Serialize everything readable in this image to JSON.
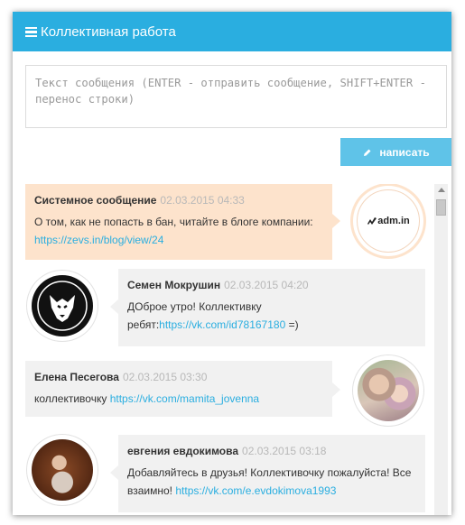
{
  "header": {
    "title": "Коллективная работа",
    "menu_icon": "menu-icon"
  },
  "composer": {
    "placeholder": "Текст сообщения (ENTER - отправить сообщение, SHIFT+ENTER - перенос строки)",
    "send_label": "написать"
  },
  "messages": [
    {
      "author": "Системное сообщение",
      "time": "02.03.2015 04:33",
      "text": "О том, как не попасть в бан, читайте в блоге компании:",
      "link": "https://zevs.in/blog/view/24",
      "avatar_label": "adm.in",
      "side": "left"
    },
    {
      "author": "Семен Мокрушин",
      "time": "02.03.2015 04:20",
      "text": "ДОброе утро! Коллективку ребят:",
      "link": "https://vk.com/id78167180",
      "suffix": " =)",
      "side": "right"
    },
    {
      "author": "Елена Песегова",
      "time": "02.03.2015 03:30",
      "text": "коллективочку",
      "link": "https://vk.com/mamita_jovenna",
      "side": "left"
    },
    {
      "author": "евгения евдокимова",
      "time": "02.03.2015 03:18",
      "text": "Добавляйтесь в друзья! Коллективочку пожалуйста! Все взаимно!",
      "link": "https://vk.com/e.evdokimova1993",
      "side": "right"
    }
  ],
  "colors": {
    "accent": "#2aaee0",
    "system_bubble": "#fde3cc",
    "bubble": "#f1f1f1",
    "button": "#5fc3e8"
  }
}
